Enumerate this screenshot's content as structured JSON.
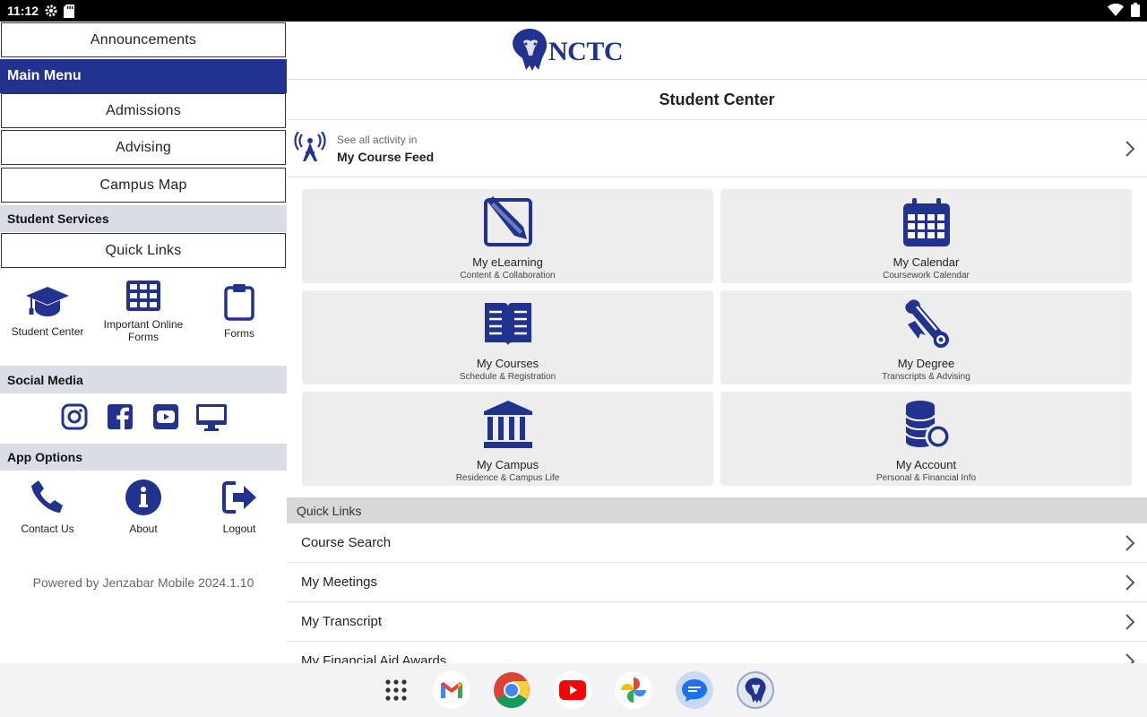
{
  "status": {
    "time": "11:12",
    "left_icons": [
      "settings-icon",
      "sd-card-icon"
    ],
    "right_icons": [
      "wifi-icon",
      "battery-icon"
    ]
  },
  "sidebar": {
    "announcements_label": "Announcements",
    "main_menu_label": "Main Menu",
    "admissions_label": "Admissions",
    "advising_label": "Advising",
    "campus_map_label": "Campus Map",
    "student_services_label": "Student Services",
    "quick_links_label": "Quick Links",
    "student_center_label": "Student Center",
    "important_forms_label": "Important Online Forms",
    "forms_label": "Forms",
    "social_media_label": "Social Media",
    "social_icons": [
      "instagram-icon",
      "facebook-icon",
      "youtube-icon",
      "monitor-icon"
    ],
    "app_options_label": "App Options",
    "contact_us_label": "Contact Us",
    "about_label": "About",
    "logout_label": "Logout",
    "powered_by": "Powered by Jenzabar Mobile 2024.1.10"
  },
  "main": {
    "logo_text": "NCTC",
    "page_title": "Student Center",
    "feed_line1": "See all activity in",
    "feed_line2": "My Course Feed",
    "tiles": [
      {
        "title": "My eLearning",
        "subtitle": "Content & Collaboration",
        "icon": "pencil-square-icon"
      },
      {
        "title": "My Calendar",
        "subtitle": "Coursework Calendar",
        "icon": "calendar-icon"
      },
      {
        "title": "My Courses",
        "subtitle": "Schedule & Registration",
        "icon": "open-book-icon"
      },
      {
        "title": "My Degree",
        "subtitle": "Transcripts & Advising",
        "icon": "diploma-scroll-icon"
      },
      {
        "title": "My Campus",
        "subtitle": "Residence & Campus Life",
        "icon": "building-columns-icon"
      },
      {
        "title": "My Account",
        "subtitle": "Personal & Financial Info",
        "icon": "coins-icon"
      }
    ],
    "quick_links_header": "Quick Links",
    "quick_links": [
      "Course Search",
      "My Meetings",
      "My Transcript",
      "My Financial Aid Awards"
    ]
  },
  "dock": {
    "apps": [
      "app-drawer-icon",
      "gmail-icon",
      "chrome-icon",
      "youtube-app-icon",
      "photos-icon",
      "messages-icon",
      "nctc-app-icon"
    ]
  },
  "colors": {
    "brand_blue": "#22338f",
    "section_gray": "#dbdde6",
    "tile_gray": "#ededed"
  }
}
